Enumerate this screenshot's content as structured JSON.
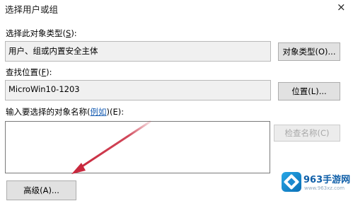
{
  "dialog": {
    "title": "选择用户或组",
    "close_glyph": "×"
  },
  "object_type": {
    "label": "选择此对象类型(",
    "label_key": "S",
    "label_end": "):",
    "value": "用户、组或内置安全主体",
    "button_label": "对象类型(O)..."
  },
  "location": {
    "label": "查找位置(",
    "label_key": "F",
    "label_end": "):",
    "value": "MicroWin10-1203",
    "button_label": "位置(L)..."
  },
  "names": {
    "label": "输入要选择的对象名称(",
    "link_text": "例如",
    "label_end": ")(E):",
    "value": "",
    "check_button_label": "检查名称(C)"
  },
  "advanced_button_label": "高级(A)...",
  "watermark": {
    "name": "963手游网",
    "url": "www.963xz.com"
  },
  "annotation": {
    "arrow_color": "#c9283d"
  }
}
